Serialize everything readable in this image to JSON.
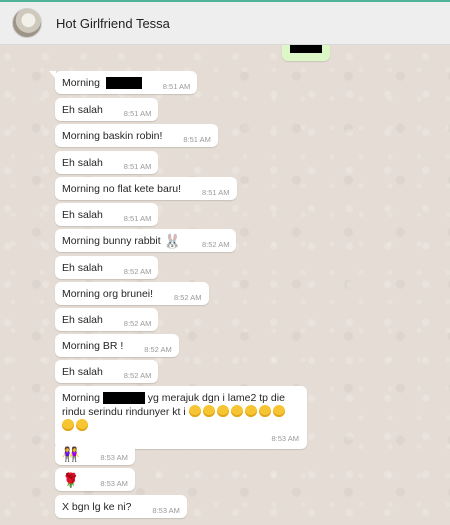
{
  "contact": {
    "name": "Hot Girlfriend Tessa"
  },
  "messages": [
    {
      "text": "Morning",
      "time": "8:51 AM"
    },
    {
      "text": "Eh salah",
      "time": "8:51 AM"
    },
    {
      "text": "Morning baskin robin!",
      "time": "8:51 AM"
    },
    {
      "text": "Eh salah",
      "time": "8:51 AM"
    },
    {
      "text": "Morning no flat kete baru!",
      "time": "8:51 AM"
    },
    {
      "text": "Eh salah",
      "time": "8:51 AM"
    },
    {
      "text": "Morning bunny rabbit",
      "time": "8:52 AM",
      "emoji": "rabbit-emoji"
    },
    {
      "text": "Eh salah",
      "time": "8:52 AM"
    },
    {
      "text": "Morning org brunei!",
      "time": "8:52 AM"
    },
    {
      "text": "Eh salah",
      "time": "8:52 AM"
    },
    {
      "text": "Morning BR !",
      "time": "8:52 AM"
    },
    {
      "text": "Eh salah",
      "time": "8:52 AM"
    },
    {
      "text_a": "Morning",
      "text_b": "yg merajuk dgn i lame2 tp die rindu serindu rindunyer kt i",
      "time": "8:53 AM",
      "emoji": "face-emoji-row"
    },
    {
      "emoji": "couple-emoji",
      "time": "8:53 AM"
    },
    {
      "emoji": "rose-emoji",
      "time": "8:53 AM"
    },
    {
      "text": "X bgn lg ke ni?",
      "time": "8:53 AM"
    }
  ]
}
